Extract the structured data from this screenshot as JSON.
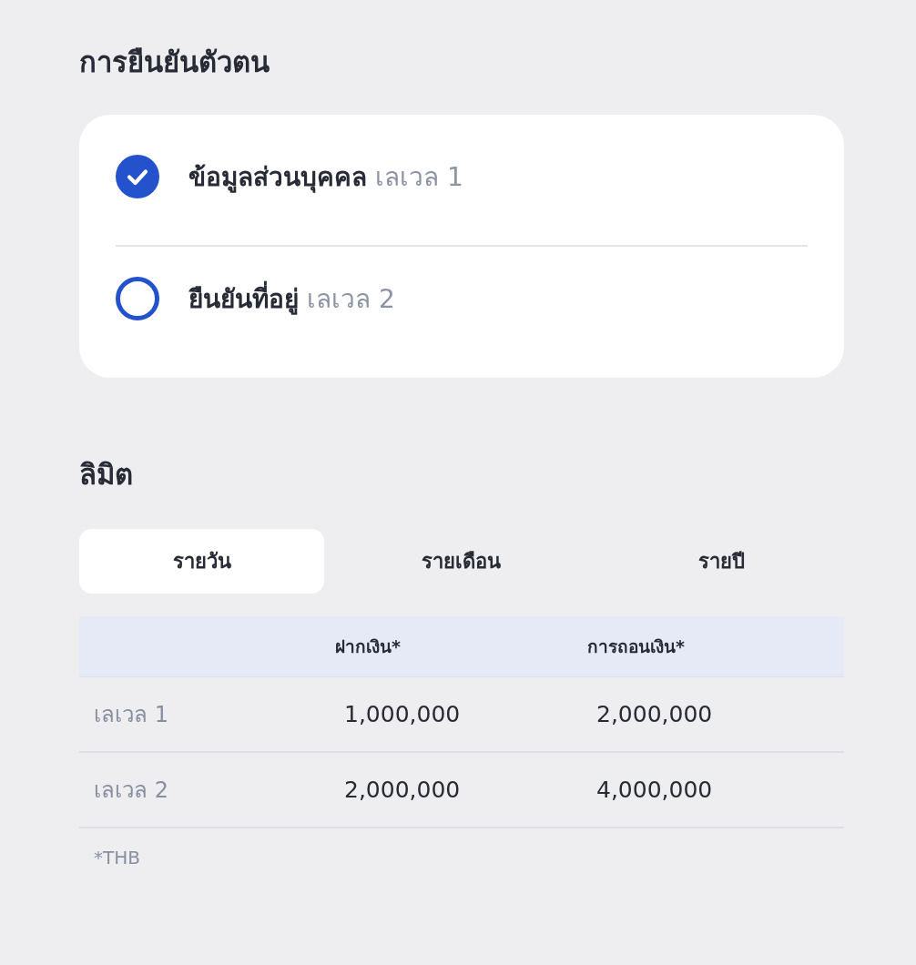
{
  "verification": {
    "title": "การยืนยันตัวตน",
    "steps": [
      {
        "label": "ข้อมูลส่วนบุคคล",
        "tier": "เลเวล 1",
        "checked": true
      },
      {
        "label": "ยืนยันที่อยู่",
        "tier": "เลเวล 2",
        "checked": false
      }
    ]
  },
  "limits": {
    "title": "ลิมิต",
    "tabs": [
      {
        "label": "รายวัน",
        "selected": true
      },
      {
        "label": "รายเดือน",
        "selected": false
      },
      {
        "label": "รายปี",
        "selected": false
      }
    ],
    "table": {
      "columns": [
        "ฝากเงิน*",
        "การถอนเงิน*"
      ],
      "rows": [
        {
          "label": "เลเวล 1",
          "values": [
            "1,000,000",
            "2,000,000"
          ]
        },
        {
          "label": "เลเวล 2",
          "values": [
            "2,000,000",
            "4,000,000"
          ]
        }
      ]
    },
    "footnote": "*THB"
  }
}
